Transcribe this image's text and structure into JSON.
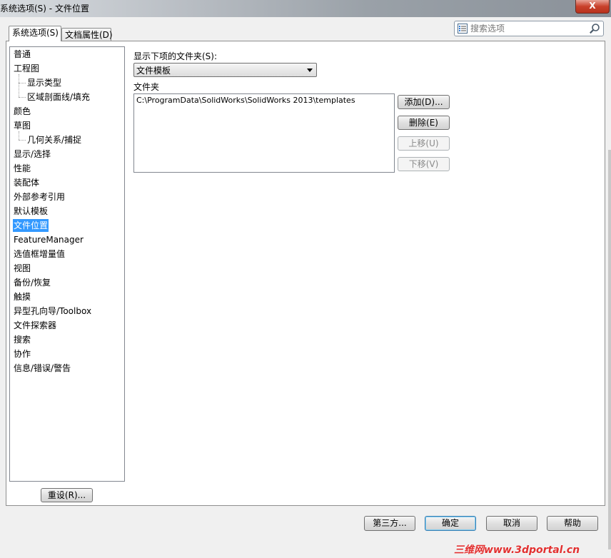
{
  "window": {
    "title": "系统选项(S) - 文件位置",
    "close_label": "X"
  },
  "tabs": [
    {
      "label": "系统选项(S)",
      "active": true
    },
    {
      "label": "文档属性(D)",
      "active": false
    }
  ],
  "search": {
    "placeholder": "搜索选项"
  },
  "tree": {
    "items": [
      {
        "label": "普通"
      },
      {
        "label": "工程图"
      },
      {
        "label": "显示类型"
      },
      {
        "label": "区域剖面线/填充"
      },
      {
        "label": "颜色"
      },
      {
        "label": "草图"
      },
      {
        "label": "几何关系/捕捉"
      },
      {
        "label": "显示/选择"
      },
      {
        "label": "性能"
      },
      {
        "label": "装配体"
      },
      {
        "label": "外部参考引用"
      },
      {
        "label": "默认模板"
      },
      {
        "label": "文件位置"
      },
      {
        "label": "FeatureManager"
      },
      {
        "label": "选值框增量值"
      },
      {
        "label": "视图"
      },
      {
        "label": "备份/恢复"
      },
      {
        "label": "触摸"
      },
      {
        "label": "异型孔向导/Toolbox"
      },
      {
        "label": "文件探索器"
      },
      {
        "label": "搜索"
      },
      {
        "label": "协作"
      },
      {
        "label": "信息/错误/警告"
      }
    ]
  },
  "reset_button": "重设(R)...",
  "show_folders_label": "显示下项的文件夹(S):",
  "folder_type": {
    "selected": "文件模板"
  },
  "folders_label": "文件夹",
  "folders": [
    "C:\\ProgramData\\SolidWorks\\SolidWorks 2013\\templates"
  ],
  "side_buttons": {
    "add": "添加(D)...",
    "delete": "删除(E)",
    "move_up": "上移(U)",
    "move_down": "下移(V)"
  },
  "footer": {
    "third_party": "第三方...",
    "ok": "确定",
    "cancel": "取消",
    "help": "帮助"
  },
  "watermark": "三维网www.3dportal.cn",
  "colors": {
    "selection": "#3399ff",
    "watermark": "#e23030"
  }
}
